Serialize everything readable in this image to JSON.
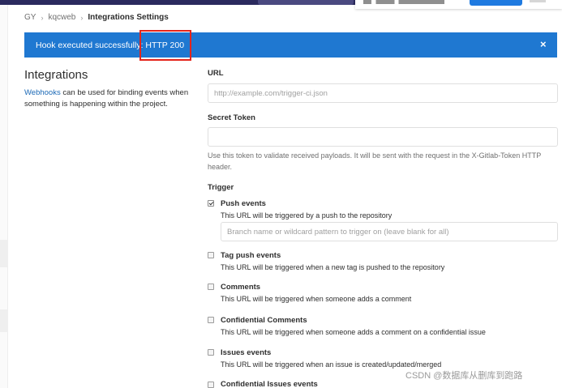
{
  "breadcrumb": [
    "GY",
    "kqcweb",
    "Integrations Settings"
  ],
  "flash": {
    "message": "Hook executed successfully: HTTP 200",
    "close": "×"
  },
  "sidebar": {
    "title": "Integrations",
    "link_text": "Webhooks",
    "description": " can be used for binding events when something is happening within the project."
  },
  "form": {
    "url_label": "URL",
    "url_placeholder": "http://example.com/trigger-ci.json",
    "token_label": "Secret Token",
    "token_value": "",
    "token_help": "Use this token to validate received payloads. It will be sent with the request in the X-Gitlab-Token HTTP header.",
    "trigger_label": "Trigger",
    "push_branch_placeholder": "Branch name or wildcard pattern to trigger on (leave blank for all)"
  },
  "events": [
    {
      "title": "Push events",
      "desc": "This URL will be triggered by a push to the repository",
      "checked": true
    },
    {
      "title": "Tag push events",
      "desc": "This URL will be triggered when a new tag is pushed to the repository",
      "checked": false
    },
    {
      "title": "Comments",
      "desc": "This URL will be triggered when someone adds a comment",
      "checked": false
    },
    {
      "title": "Confidential Comments",
      "desc": "This URL will be triggered when someone adds a comment on a confidential issue",
      "checked": false
    },
    {
      "title": "Issues events",
      "desc": "This URL will be triggered when an issue is created/updated/merged",
      "checked": false
    },
    {
      "title": "Confidential Issues events",
      "desc": "",
      "checked": false
    }
  ],
  "watermark": "CSDN @数据库从删库到跑路",
  "colors": {
    "flash_bg": "#1f78d1",
    "link": "#1b69b6",
    "annotation": "#e4241b",
    "topbar": "#2b2a5e"
  }
}
